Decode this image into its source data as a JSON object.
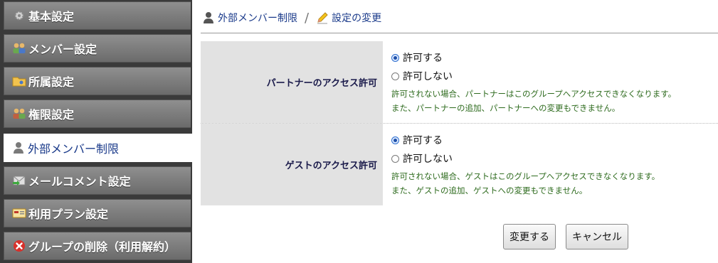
{
  "sidebar": {
    "items": [
      {
        "label": "基本設定",
        "icon": "gear-icon"
      },
      {
        "label": "メンバー設定",
        "icon": "members-icon"
      },
      {
        "label": "所属設定",
        "icon": "folder-icon"
      },
      {
        "label": "権限設定",
        "icon": "permissions-icon"
      },
      {
        "label": "外部メンバー制限",
        "icon": "person-icon",
        "active": true
      },
      {
        "label": "メールコメント設定",
        "icon": "mail-icon"
      },
      {
        "label": "利用プラン設定",
        "icon": "plan-card-icon"
      },
      {
        "label": "グループの削除（利用解約）",
        "icon": "delete-icon"
      }
    ]
  },
  "breadcrumb": {
    "parent": "外部メンバー制限",
    "separator": "/",
    "current": "設定の変更"
  },
  "settings": {
    "partner": {
      "label": "パートナーのアクセス許可",
      "options": [
        "許可する",
        "許可しない"
      ],
      "selected": "許可する",
      "note_line1": "許可されない場合、パートナーはこのグループへアクセスできなくなります。",
      "note_line2": "また、パートナーの追加、パートナーへの変更もできません。"
    },
    "guest": {
      "label": "ゲストのアクセス許可",
      "options": [
        "許可する",
        "許可しない"
      ],
      "selected": "許可する",
      "note_line1": "許可されない場合、ゲストはこのグループへアクセスできなくなります。",
      "note_line2": "また、ゲストの追加、ゲストへの変更もできません。"
    }
  },
  "actions": {
    "submit_label": "変更する",
    "cancel_label": "キャンセル"
  },
  "colors": {
    "sidebar_bg": "#3a3a3a",
    "link": "#1a3a8a",
    "note_text": "#2e6b1e",
    "label_bg": "#e2e2e2"
  }
}
